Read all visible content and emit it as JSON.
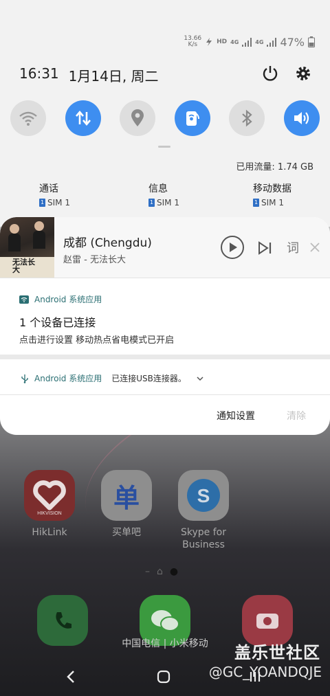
{
  "status_bar": {
    "net_speed_value": "13.66",
    "net_speed_unit": "K/s",
    "hd_label": "HD",
    "network_4g_1": "4G",
    "network_4g_2": "4G",
    "battery_percent": "47%",
    "icons": [
      "bolt-icon",
      "signal-icon",
      "battery-icon"
    ]
  },
  "header": {
    "time": "16:31",
    "date": "1月14日, 周二",
    "icons": [
      "power-icon",
      "gear-icon"
    ]
  },
  "quick_tiles": [
    {
      "name": "wifi",
      "icon": "wifi-icon",
      "state": "off"
    },
    {
      "name": "mobile-data",
      "icon": "data-arrows-icon",
      "state": "on"
    },
    {
      "name": "location",
      "icon": "location-pin-icon",
      "state": "off"
    },
    {
      "name": "hotspot",
      "icon": "hotspot-icon",
      "state": "on"
    },
    {
      "name": "bluetooth",
      "icon": "bluetooth-icon",
      "state": "off"
    },
    {
      "name": "sound",
      "icon": "speaker-icon",
      "state": "on"
    }
  ],
  "data_usage": "已用流量: 1.74 GB",
  "sim_settings": [
    {
      "title": "通话",
      "sim": "SIM 1",
      "badge": "1"
    },
    {
      "title": "信息",
      "sim": "SIM 1",
      "badge": "1"
    },
    {
      "title": "移动数据",
      "sim": "SIM 1",
      "badge": "1"
    }
  ],
  "media": {
    "title": "成都 (Chengdu)",
    "artist": "赵雷 - 无法长大",
    "art_text": "无法长大",
    "lyric_button": "词",
    "icons": [
      "play-icon",
      "skip-next-icon",
      "close-icon"
    ]
  },
  "notification_1": {
    "app": "Android 系统应用",
    "title": "1 个设备已连接",
    "text": "点击进行设置 移动热点省电模式已开启",
    "icon": "wifi-small-icon"
  },
  "notification_2": {
    "app": "Android 系统应用",
    "text": "已连接USB连接器。",
    "icon": "usb-icon"
  },
  "footer": {
    "settings": "通知设置",
    "clear": "清除"
  },
  "home": {
    "apps": [
      {
        "label": "HikLink",
        "sublabel": "HIKVISION"
      },
      {
        "label": "买单吧",
        "glyph": "单"
      },
      {
        "label": "Skype for\nBusiness",
        "label_line1": "Skype for",
        "label_line2": "Business"
      }
    ],
    "carrier": "中国电信 | 小米移动",
    "watermark_title": "盖乐世社区",
    "watermark_sub": "@GC_YOANDQJE"
  },
  "colors": {
    "accent_blue": "#3e8ef0",
    "tile_off": "#dedede",
    "app_name_teal": "#2b6f73"
  }
}
